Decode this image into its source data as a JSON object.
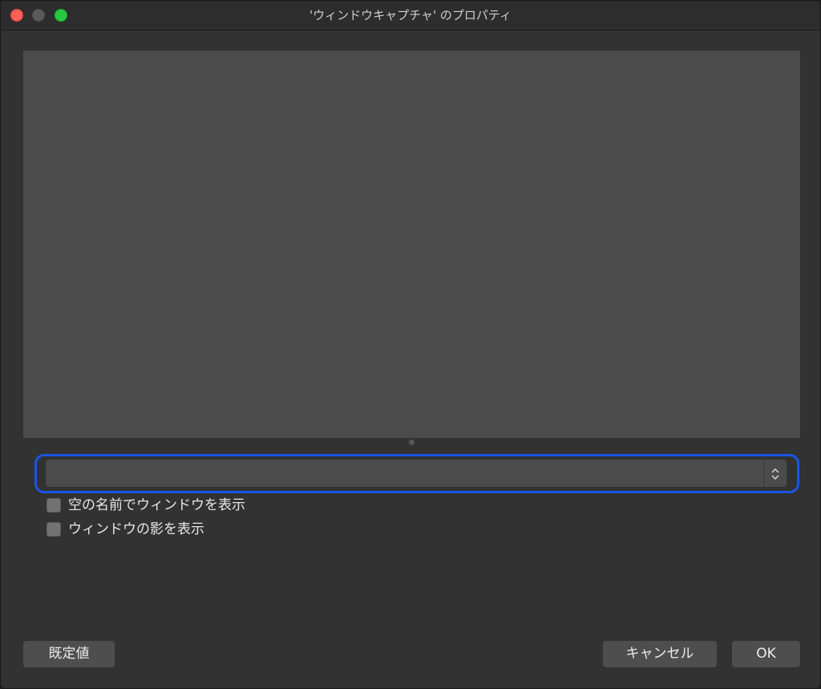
{
  "window": {
    "title": "'ウィンドウキャプチャ' のプロパティ"
  },
  "window_select": {
    "value": "",
    "arrows_icon": "up-down-chevron-icon"
  },
  "options": [
    {
      "label": "空の名前でウィンドウを表示",
      "checked": false
    },
    {
      "label": "ウィンドウの影を表示",
      "checked": false
    }
  ],
  "buttons": {
    "defaults": "既定値",
    "cancel": "キャンセル",
    "ok": "OK"
  },
  "colors": {
    "focus_ring": "#1a56e6",
    "close": "#ff5f57",
    "maximize": "#28c840"
  }
}
